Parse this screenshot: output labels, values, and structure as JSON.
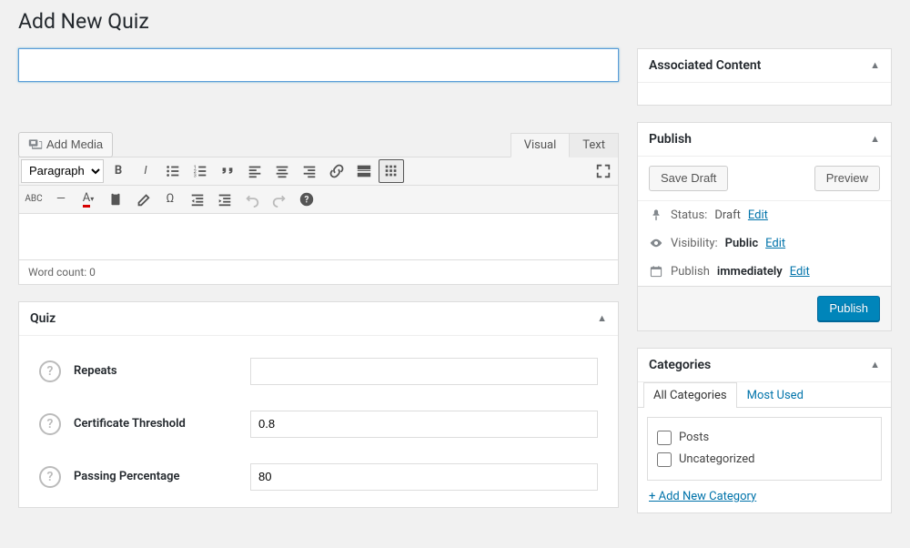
{
  "page": {
    "title": "Add New Quiz"
  },
  "title_input": {
    "value": "",
    "placeholder": ""
  },
  "media": {
    "add_media": "Add Media"
  },
  "editor": {
    "tabs": {
      "visual": "Visual",
      "text": "Text"
    },
    "format_select": "Paragraph",
    "word_count_label": "Word count: 0"
  },
  "quiz_box": {
    "heading": "Quiz",
    "fields": {
      "repeats": {
        "label": "Repeats",
        "value": ""
      },
      "cert_threshold": {
        "label": "Certificate Threshold",
        "value": "0.8"
      },
      "passing_pct": {
        "label": "Passing Percentage",
        "value": "80"
      }
    }
  },
  "associated_content": {
    "heading": "Associated Content"
  },
  "publish": {
    "heading": "Publish",
    "save_draft": "Save Draft",
    "preview": "Preview",
    "status_label": "Status:",
    "status_value": "Draft",
    "visibility_label": "Visibility:",
    "visibility_value": "Public",
    "publish_label": "Publish",
    "publish_value": "immediately",
    "edit": "Edit",
    "publish_button": "Publish"
  },
  "categories": {
    "heading": "Categories",
    "tabs": {
      "all": "All Categories",
      "most_used": "Most Used"
    },
    "items": {
      "posts": "Posts",
      "uncategorized": "Uncategorized"
    },
    "add_new": "+ Add New Category"
  }
}
